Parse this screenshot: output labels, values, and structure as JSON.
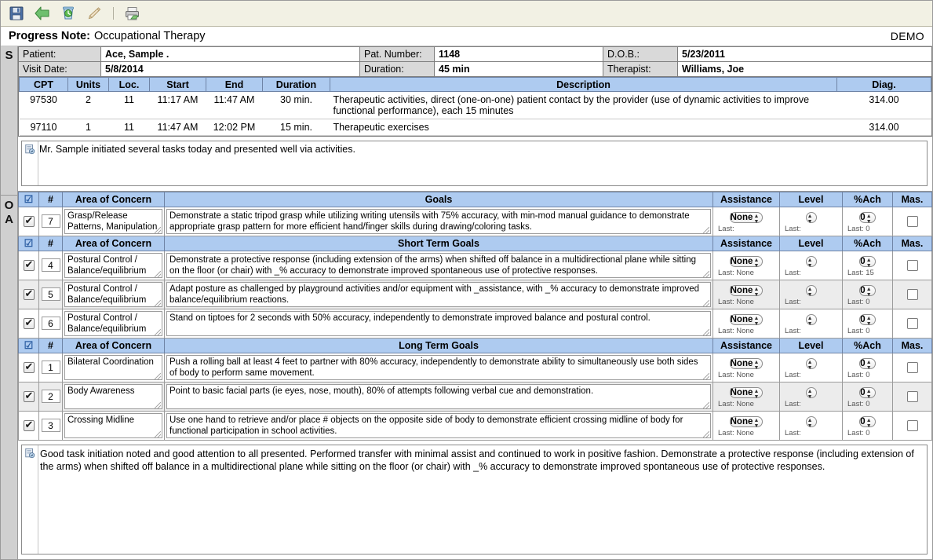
{
  "toolbar": {
    "buttons": [
      {
        "name": "save-icon",
        "label": "Save"
      },
      {
        "name": "back-arrow-icon",
        "label": "Back"
      },
      {
        "name": "refresh-trash-icon",
        "label": "Refresh"
      },
      {
        "name": "edit-pencil-icon",
        "label": "Edit"
      },
      {
        "name": "print-icon",
        "label": "Print"
      }
    ]
  },
  "header": {
    "title_label": "Progress Note:",
    "title_value": "Occupational Therapy",
    "demo_badge": "DEMO"
  },
  "gutter": {
    "s": "S",
    "o": "O",
    "a": "A"
  },
  "patient": {
    "patient_label": "Patient:",
    "patient_value": "Ace, Sample .",
    "pat_number_label": "Pat. Number:",
    "pat_number_value": "1148",
    "dob_label": "D.O.B.:",
    "dob_value": "5/23/2011",
    "visit_date_label": "Visit Date:",
    "visit_date_value": "5/8/2014",
    "duration_label": "Duration:",
    "duration_value": "45 min",
    "therapist_label": "Therapist:",
    "therapist_value": "Williams, Joe"
  },
  "cpt": {
    "columns": [
      "CPT",
      "Units",
      "Loc.",
      "Start",
      "End",
      "Duration",
      "Description",
      "Diag."
    ],
    "rows": [
      {
        "cpt": "97530",
        "units": "2",
        "loc": "11",
        "start": "11:17 AM",
        "end": "11:47 AM",
        "duration": "30 min.",
        "description": "Therapeutic activities, direct (one-on-one) patient contact by the provider (use of dynamic activities to improve functional performance), each 15 minutes",
        "diag": "314.00"
      },
      {
        "cpt": "97110",
        "units": "1",
        "loc": "11",
        "start": "11:47 AM",
        "end": "12:02 PM",
        "duration": "15 min.",
        "description": "Therapeutic exercises",
        "diag": "314.00"
      }
    ]
  },
  "subjective_note": {
    "text": "Mr. Sample initiated several tasks today and presented well via activities."
  },
  "goal_sections": [
    {
      "id": "current-goals",
      "columns": {
        "check": "",
        "num": "#",
        "area": "Area of Concern",
        "goals": "Goals",
        "assistance": "Assistance",
        "level": "Level",
        "pct": "%Ach",
        "mas": "Mas."
      },
      "rows": [
        {
          "checked": true,
          "num": "7",
          "area": "Grasp/Release Patterns, Manipulation skills",
          "goal": "Demonstrate a static tripod grasp while utilizing writing utensils with 75% accuracy, with min-mod manual guidance to demonstrate appropriate grasp pattern for more efficient hand/finger skills during drawing/coloring tasks.",
          "assistance": "None",
          "assistance_last": "Last:",
          "level": "",
          "level_last": "Last:",
          "pct": "0",
          "pct_last": "Last: 0",
          "mastered": false
        }
      ]
    },
    {
      "id": "short-term-goals",
      "columns": {
        "check": "",
        "num": "#",
        "area": "Area of Concern",
        "goals": "Short Term Goals",
        "assistance": "Assistance",
        "level": "Level",
        "pct": "%Ach",
        "mas": "Mas."
      },
      "rows": [
        {
          "checked": true,
          "num": "4",
          "area": "Postural Control / Balance/equilibrium",
          "goal": "Demonstrate a protective response (including extension of the arms) when shifted off balance in a multidirectional plane while sitting on the floor (or chair) with _% accuracy to demonstrate improved spontaneous use of protective responses.",
          "assistance": "None",
          "assistance_last": "Last: None",
          "level": "",
          "level_last": "Last:",
          "pct": "0",
          "pct_last": "Last: 15",
          "mastered": false
        },
        {
          "checked": true,
          "num": "5",
          "area": "Postural Control / Balance/equilibrium",
          "goal": "Adapt posture as challenged by playground activities and/or equipment with _assistance, with _% accuracy to demonstrate improved balance/equilibrium reactions.",
          "assistance": "None",
          "assistance_last": "Last: None",
          "level": "",
          "level_last": "Last:",
          "pct": "0",
          "pct_last": "Last: 0",
          "mastered": false
        },
        {
          "checked": true,
          "num": "6",
          "area": "Postural Control / Balance/equilibrium",
          "goal": "Stand on tiptoes for 2 seconds with 50% accuracy, independently to demonstrate improved balance and postural control.",
          "assistance": "None",
          "assistance_last": "Last: None",
          "level": "",
          "level_last": "Last:",
          "pct": "0",
          "pct_last": "Last: 0",
          "mastered": false
        }
      ]
    },
    {
      "id": "long-term-goals",
      "columns": {
        "check": "",
        "num": "#",
        "area": "Area of Concern",
        "goals": "Long Term Goals",
        "assistance": "Assistance",
        "level": "Level",
        "pct": "%Ach",
        "mas": "Mas."
      },
      "rows": [
        {
          "checked": true,
          "num": "1",
          "area": "Bilateral Coordination",
          "goal": "Push a rolling ball at least 4 feet to partner with 80% accuracy, independently to demonstrate ability to simultaneously use both sides of body to perform same movement.",
          "assistance": "None",
          "assistance_last": "Last: None",
          "level": "",
          "level_last": "Last:",
          "pct": "0",
          "pct_last": "Last: 0",
          "mastered": false
        },
        {
          "checked": true,
          "num": "2",
          "area": "Body Awareness",
          "goal": "Point to basic facial parts (ie eyes, nose, mouth), 80% of attempts following verbal cue and demonstration.",
          "assistance": "None",
          "assistance_last": "Last: None",
          "level": "",
          "level_last": "Last:",
          "pct": "0",
          "pct_last": "Last: 0",
          "mastered": false
        },
        {
          "checked": true,
          "num": "3",
          "area": "Crossing Midline",
          "goal": "Use one hand to retrieve and/or place # objects on the opposite side of body to demonstrate efficient crossing midline of body for functional participation in school activities.",
          "assistance": "None",
          "assistance_last": "Last: None",
          "level": "",
          "level_last": "Last:",
          "pct": "0",
          "pct_last": "Last: 0",
          "mastered": false
        }
      ]
    }
  ],
  "assessment_note": {
    "text": "Good task initiation noted and good attention to all presented.  Performed transfer with minimal assist and continued to work in positive fashion.  Demonstrate a protective response (including extension of the arms) when shifted off balance in a multidirectional plane while sitting on the floor (or chair) with _% accuracy to demonstrate improved spontaneous use of protective responses."
  },
  "colors": {
    "header_blue": "#aecbf0",
    "toolbar_bg": "#f2f1e4",
    "gutter_bg": "#d0d0d0",
    "alt_row": "#ececec"
  }
}
